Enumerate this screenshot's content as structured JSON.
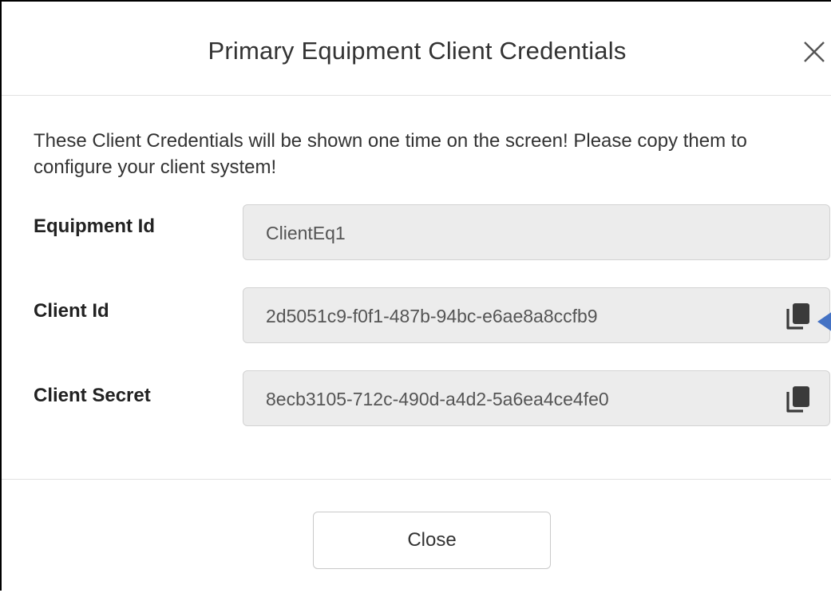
{
  "dialog": {
    "title": "Primary Equipment Client Credentials",
    "intro": "These Client Credentials will be shown one time on the screen! Please copy them to configure your client system!",
    "fields": [
      {
        "label": "Equipment Id",
        "value": "ClientEq1",
        "copyable": false
      },
      {
        "label": "Client Id",
        "value": "2d5051c9-f0f1-487b-94bc-e6ae8a8ccfb9",
        "copyable": true
      },
      {
        "label": "Client Secret",
        "value": "8ecb3105-712c-490d-a4d2-5a6ea4ce4fe0",
        "copyable": true
      }
    ],
    "close_button_label": "Close"
  },
  "icons": {
    "close": "close-x-icon",
    "copy": "copy-icon",
    "pointer": "arrow-pointer-icon"
  },
  "colors": {
    "field_background": "#ececec",
    "field_border": "#d3d3d3",
    "copy_icon": "#3a3a3a",
    "pointer_arrow": "#4472c4"
  }
}
